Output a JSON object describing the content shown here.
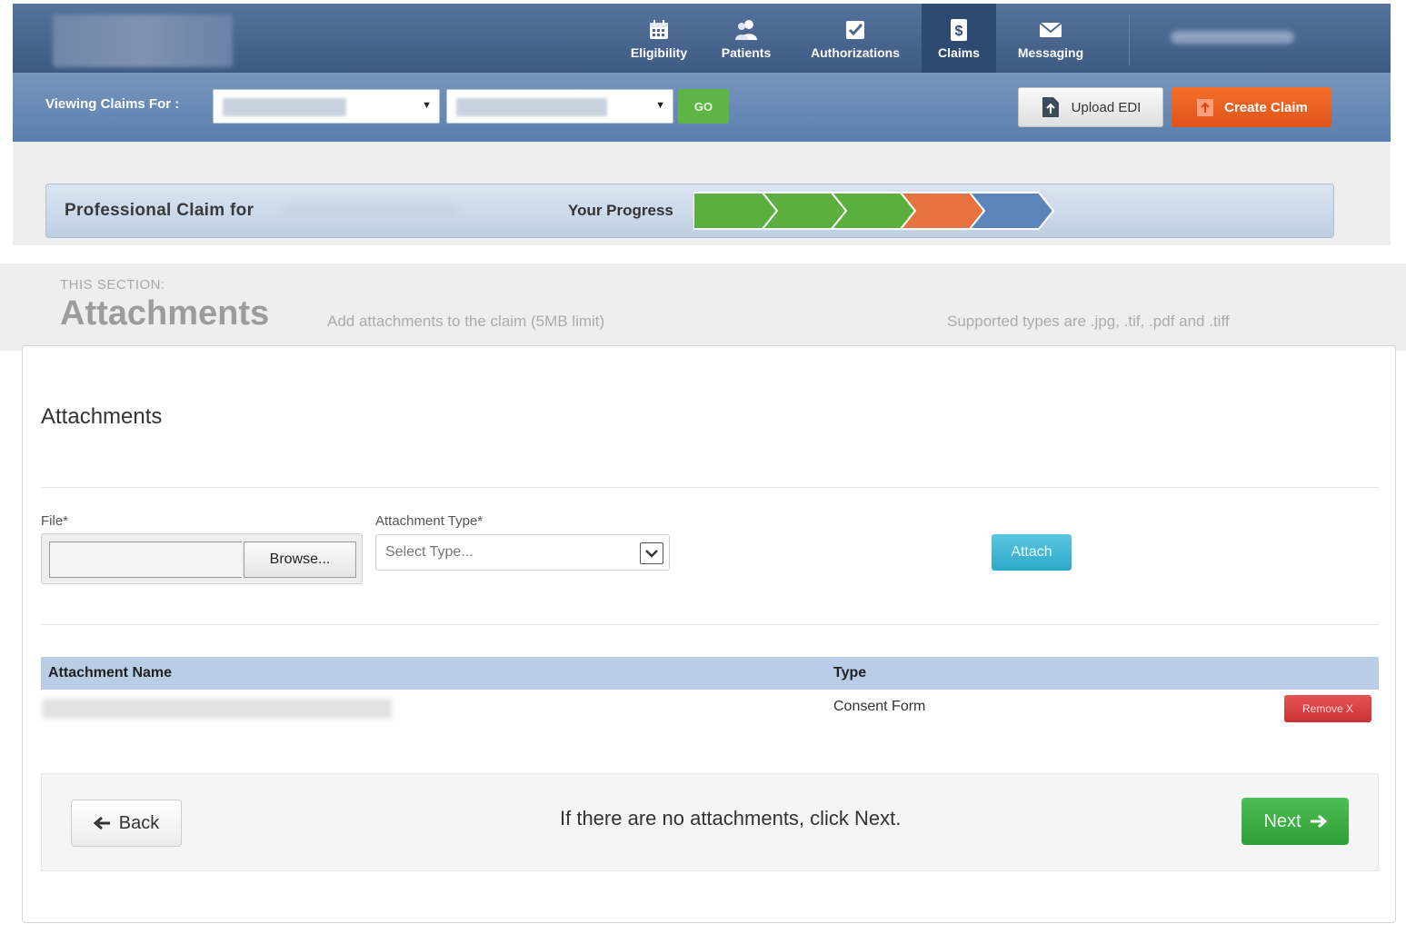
{
  "nav": {
    "items": [
      {
        "label": "Eligibility",
        "icon": "calendar-icon"
      },
      {
        "label": "Patients",
        "icon": "people-icon"
      },
      {
        "label": "Authorizations",
        "icon": "checkbox-icon"
      },
      {
        "label": "Claims",
        "icon": "dollar-document-icon"
      },
      {
        "label": "Messaging",
        "icon": "envelope-icon"
      }
    ],
    "active": "Claims"
  },
  "subnav": {
    "viewing_label": "Viewing Claims For :",
    "go_label": "GO",
    "upload_label": "Upload EDI",
    "create_label": "Create Claim"
  },
  "progress": {
    "claim_title": "Professional Claim for",
    "label": "Your Progress",
    "steps": [
      {
        "status": "complete",
        "color": "#5aaf3f"
      },
      {
        "status": "complete",
        "color": "#5aaf3f"
      },
      {
        "status": "complete",
        "color": "#5aaf3f"
      },
      {
        "status": "current",
        "color": "#e8723f"
      },
      {
        "status": "upcoming",
        "color": "#5a84ba"
      }
    ]
  },
  "section": {
    "kicker": "THIS SECTION:",
    "title": "Attachments",
    "description": "Add attachments to the claim (5MB limit)",
    "supported": "Supported types are .jpg, .tif, .pdf and .tiff"
  },
  "panel": {
    "title": "Attachments",
    "file_label": "File*",
    "browse_label": "Browse...",
    "type_label": "Attachment Type*",
    "type_placeholder": "Select Type...",
    "attach_label": "Attach"
  },
  "table": {
    "headers": [
      "Attachment Name",
      "Type"
    ],
    "rows": [
      {
        "type": "Consent Form",
        "remove_label": "Remove X"
      }
    ]
  },
  "footer": {
    "back_label": "Back",
    "message": "If there are no attachments, click Next.",
    "next_label": "Next"
  },
  "colors": {
    "nav_bg": "#3e5a83",
    "subnav_bg": "#5b7fae",
    "go": "#5eb546",
    "create": "#e0541b",
    "attach": "#2ea9c9",
    "remove": "#c93232",
    "next": "#2f9f39"
  }
}
